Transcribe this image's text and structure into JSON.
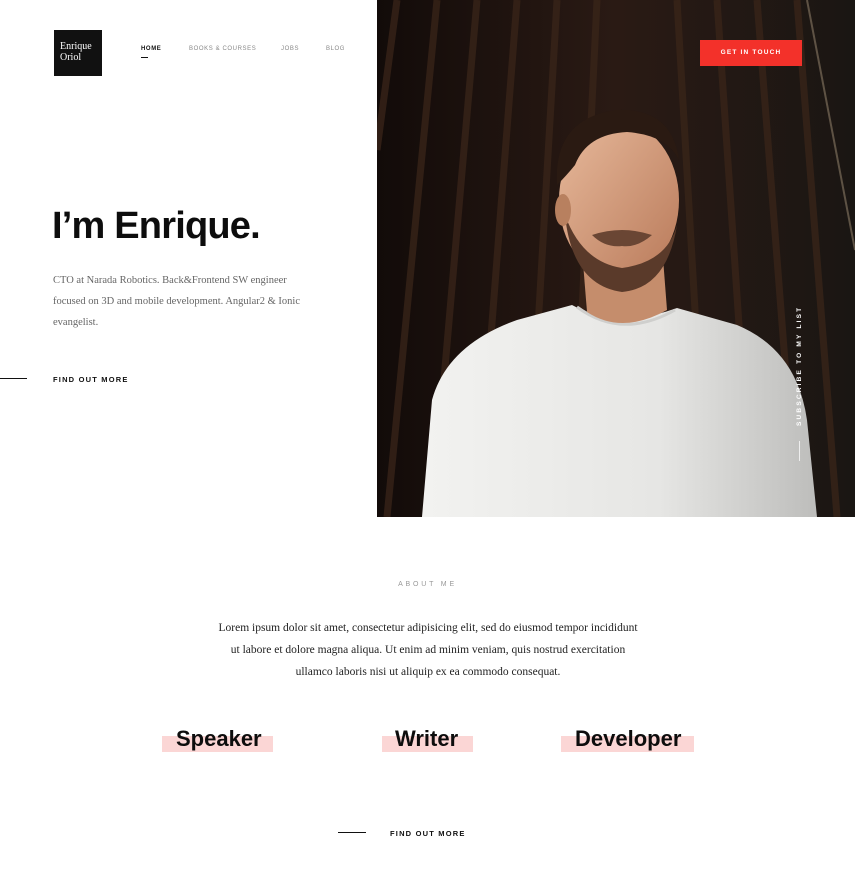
{
  "logo": {
    "line1": "Enrique",
    "line2": "Oriol"
  },
  "nav": {
    "items": [
      "HOME",
      "BOOKS & COURSES",
      "JOBS",
      "BLOG"
    ],
    "active": "HOME"
  },
  "cta": {
    "label": "GET IN TOUCH"
  },
  "hero": {
    "headline": "I’m Enrique.",
    "bio": "CTO at Narada Robotics. Back&Frontend SW engineer focused on 3D and mobile development. Angular2 & Ionic evangelist.",
    "find_more": "FIND OUT MORE"
  },
  "subscribe": {
    "label": "SUBSCRIBE TO MY LIST"
  },
  "about": {
    "label": "ABOUT ME",
    "text": "Lorem ipsum dolor sit amet, consectetur adipisicing elit, sed do eiusmod tempor incididunt ut labore et dolore magna aliqua. Ut enim ad minim veniam, quis nostrud exercitation ullamco laboris nisi ut aliquip ex ea commodo consequat.",
    "roles": [
      "Speaker",
      "Writer",
      "Developer"
    ],
    "find_more": "FIND OUT MORE"
  },
  "colors": {
    "accent": "#f3312a",
    "highlight": "#fbd6d5",
    "logo_bg": "#111111"
  }
}
